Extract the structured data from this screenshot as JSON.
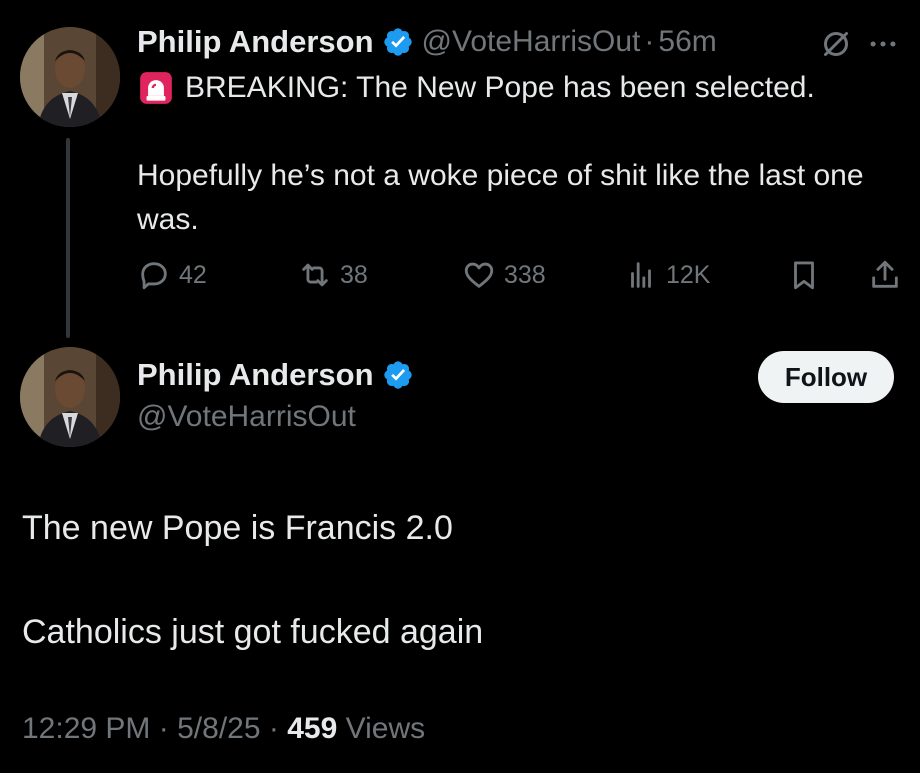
{
  "tweet1": {
    "author_name": "Philip Anderson",
    "handle": "@VoteHarrisOut",
    "separator": "·",
    "time": "56m",
    "text_line1": "BREAKING: The New Pope has been selected.",
    "text_line2": "Hopefully he’s not a woke piece of shit like the last one was.",
    "metrics": {
      "replies": "42",
      "reposts": "38",
      "likes": "338",
      "views": "12K"
    },
    "icons": {
      "siren": "siren-emoji-icon",
      "verified": "verified-badge-icon",
      "grok": "grok-icon",
      "more": "more-options-icon",
      "reply": "reply-icon",
      "repost": "repost-icon",
      "like": "heart-icon",
      "views": "analytics-icon",
      "bookmark": "bookmark-icon",
      "share": "share-icon"
    }
  },
  "tweet2": {
    "author_name": "Philip Anderson",
    "handle": "@VoteHarrisOut",
    "follow_label": "Follow",
    "text_line1": "The new Pope is Francis 2.0",
    "text_line2": "Catholics just got fucked again",
    "time": "12:29 PM",
    "date": "5/8/25",
    "separator": "·",
    "views_count": "459",
    "views_label": "Views"
  },
  "colors": {
    "background": "#000000",
    "primary_text": "#e7e9ea",
    "secondary_text": "#71767b",
    "verified_blue": "#1d9bf0",
    "follow_button_bg": "#eff3f4"
  }
}
